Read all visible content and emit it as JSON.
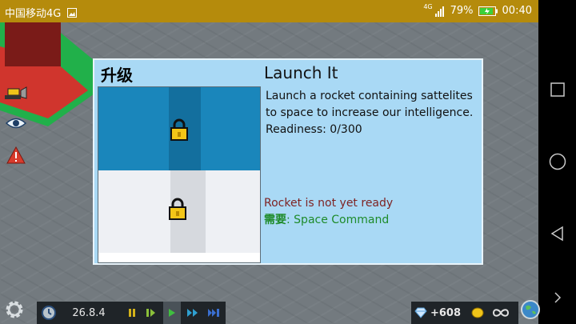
{
  "status_bar": {
    "carrier": "中国移动4G",
    "signal_label": "4G",
    "battery": "79%",
    "time": "00:40"
  },
  "dialog": {
    "title": "升级",
    "name": "Launch It",
    "description": "Launch a rocket containing sattelites to space to increase our intelligence.",
    "readiness": "Readiness: 0/300",
    "status": "Rocket is not yet ready",
    "requires_label": "需要",
    "requires_value": ": Space Command"
  },
  "toolbar": {
    "date": "26.8.4",
    "diamonds": "+608"
  },
  "colors": {
    "status_bar": "#b58b0c",
    "dialog_bg": "#a9d9f5",
    "not_ready": "#7e2323",
    "requires": "#1e8b2a"
  },
  "icons": [
    "gear-icon",
    "clock-icon",
    "pause-icon",
    "play-icon",
    "fast-forward-icon",
    "diamond-icon",
    "coin-icon",
    "infinity-icon",
    "globe-icon",
    "lock-icon",
    "eye-icon",
    "warning-icon",
    "bulldozer-icon"
  ]
}
